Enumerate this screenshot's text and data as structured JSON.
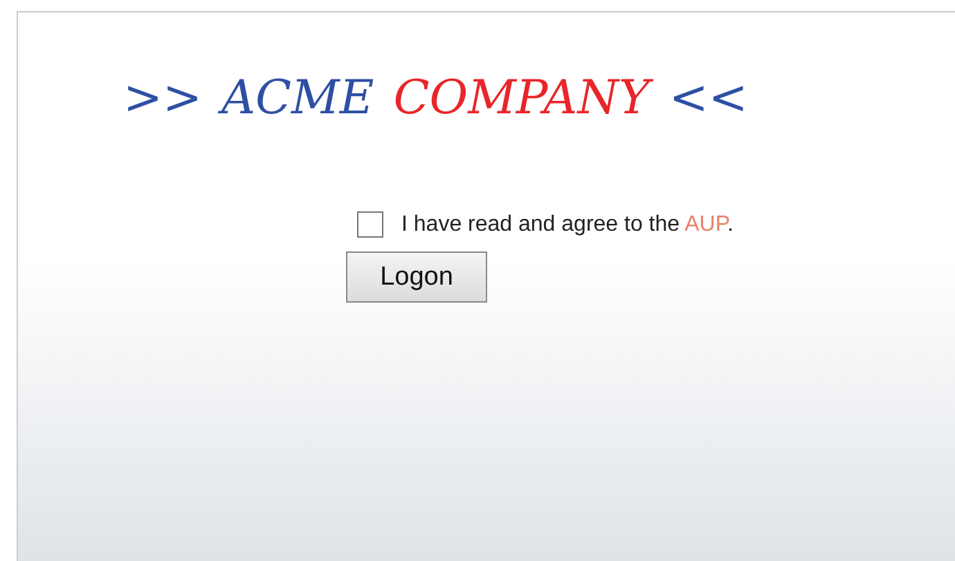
{
  "logo": [
    {
      "text": ">>",
      "color": "#2e4fa3"
    },
    {
      "text": "ACME",
      "color": "#2e4fa3"
    },
    {
      "text": "COMPANY",
      "color": "#e8262a"
    },
    {
      "text": "<<",
      "color": "#2e4fa3"
    }
  ],
  "agreement": {
    "checked": false,
    "before": "I have read and agree to the ",
    "link": "AUP",
    "after": "."
  },
  "button": "Logon"
}
